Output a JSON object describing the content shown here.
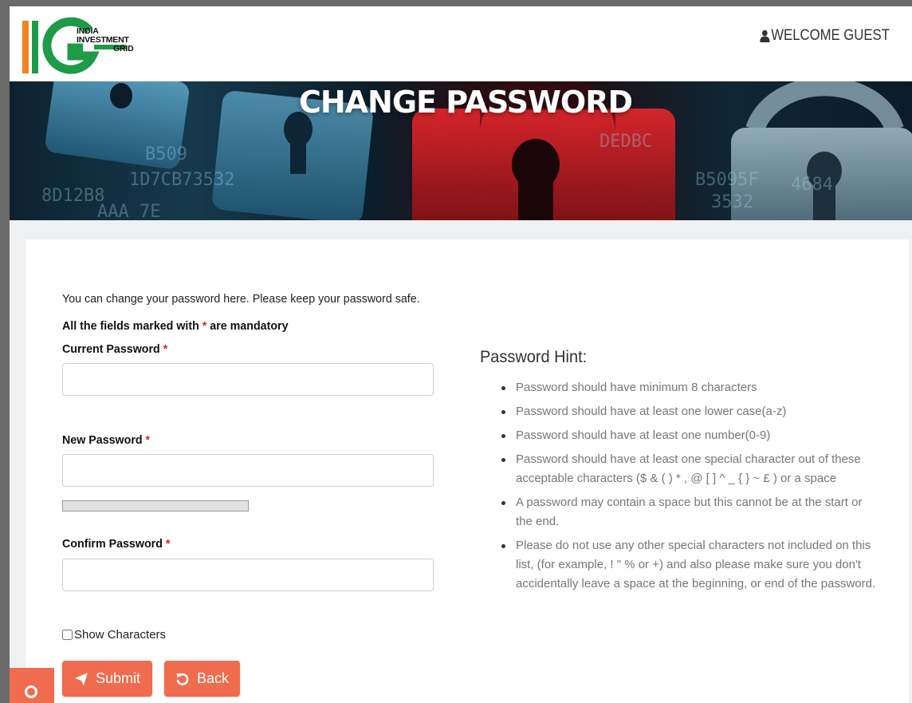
{
  "header": {
    "logo_lines": [
      "INDIA",
      "INVESTMENT",
      "GRID"
    ],
    "welcome": "WELCOME GUEST"
  },
  "banner": {
    "title": "CHANGE PASSWORD"
  },
  "form": {
    "intro": "You can change your password here. Please keep your password safe.",
    "mandatory_prefix": "All the fields marked with",
    "required_marker": "*",
    "mandatory_suffix": "are mandatory",
    "current_label": "Current Password",
    "current_value": "",
    "new_label": "New Password",
    "new_value": "",
    "strength_percent": 0,
    "confirm_label": "Confirm Password",
    "confirm_value": "",
    "show_characters": "Show Characters",
    "show_checked": false,
    "submit": "Submit",
    "back": "Back"
  },
  "hints": {
    "title": "Password Hint:",
    "items": [
      "Password should have minimum 8 characters",
      "Password should have at least one lower case(a-z)",
      "Password should have at least one number(0-9)",
      "Password should have at least one special character out of these acceptable characters ($ & ( ) * , @ [ ] ^ _ { } ~ £ ) or a space",
      "A password may contain a space but this cannot be at the start or the end.",
      "Please do not use any other special characters not included on this list, (for example, ! \" % or +) and also please make sure you don't accidentally leave a space at the beginning, or end of the password."
    ]
  },
  "colors": {
    "accent": "#ef6c4e",
    "required": "#e02020",
    "logo_orange": "#f5821f",
    "logo_green": "#1e9a48"
  },
  "icons": {
    "user": "user-icon",
    "submit": "paper-plane-icon",
    "back": "undo-icon",
    "search": "search-icon"
  }
}
